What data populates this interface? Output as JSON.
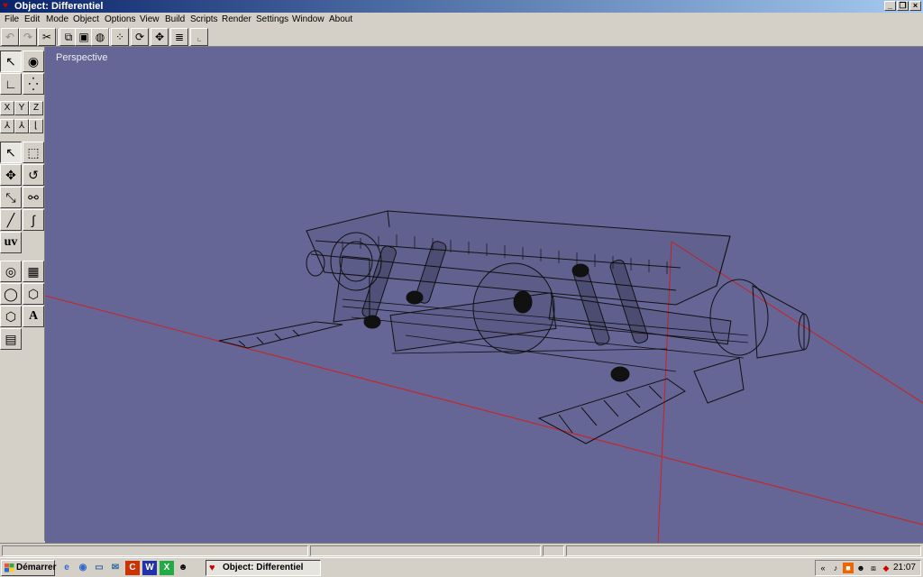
{
  "window": {
    "title": "Object: Differentiel",
    "minimize_label": "_",
    "restore_label": "❐",
    "close_label": "×"
  },
  "menu": {
    "items": [
      "File",
      "Edit",
      "Mode",
      "Object",
      "Options",
      "View",
      "Build",
      "Scripts",
      "Render",
      "Settings",
      "Window",
      "About"
    ]
  },
  "toolbar": {
    "icons": [
      "undo-icon",
      "redo-icon",
      "cut-icon",
      "copy-icon",
      "paste-icon",
      "sphere-icon",
      "group-icon",
      "rotate-icon",
      "snap-icon",
      "list-icon",
      "graph-icon"
    ]
  },
  "palette": {
    "axes": [
      "X",
      "Y",
      "Z"
    ],
    "uv_label": "uv",
    "text_label": "A"
  },
  "viewport": {
    "label": "Perspective",
    "background": "#656596",
    "wire_color": "#000000",
    "axis_color": "#cc2222"
  },
  "taskbar": {
    "start_label": "Démarrer",
    "task_label": "Object: Differentiel",
    "tray_chevron": "«",
    "clock": "21:07"
  }
}
